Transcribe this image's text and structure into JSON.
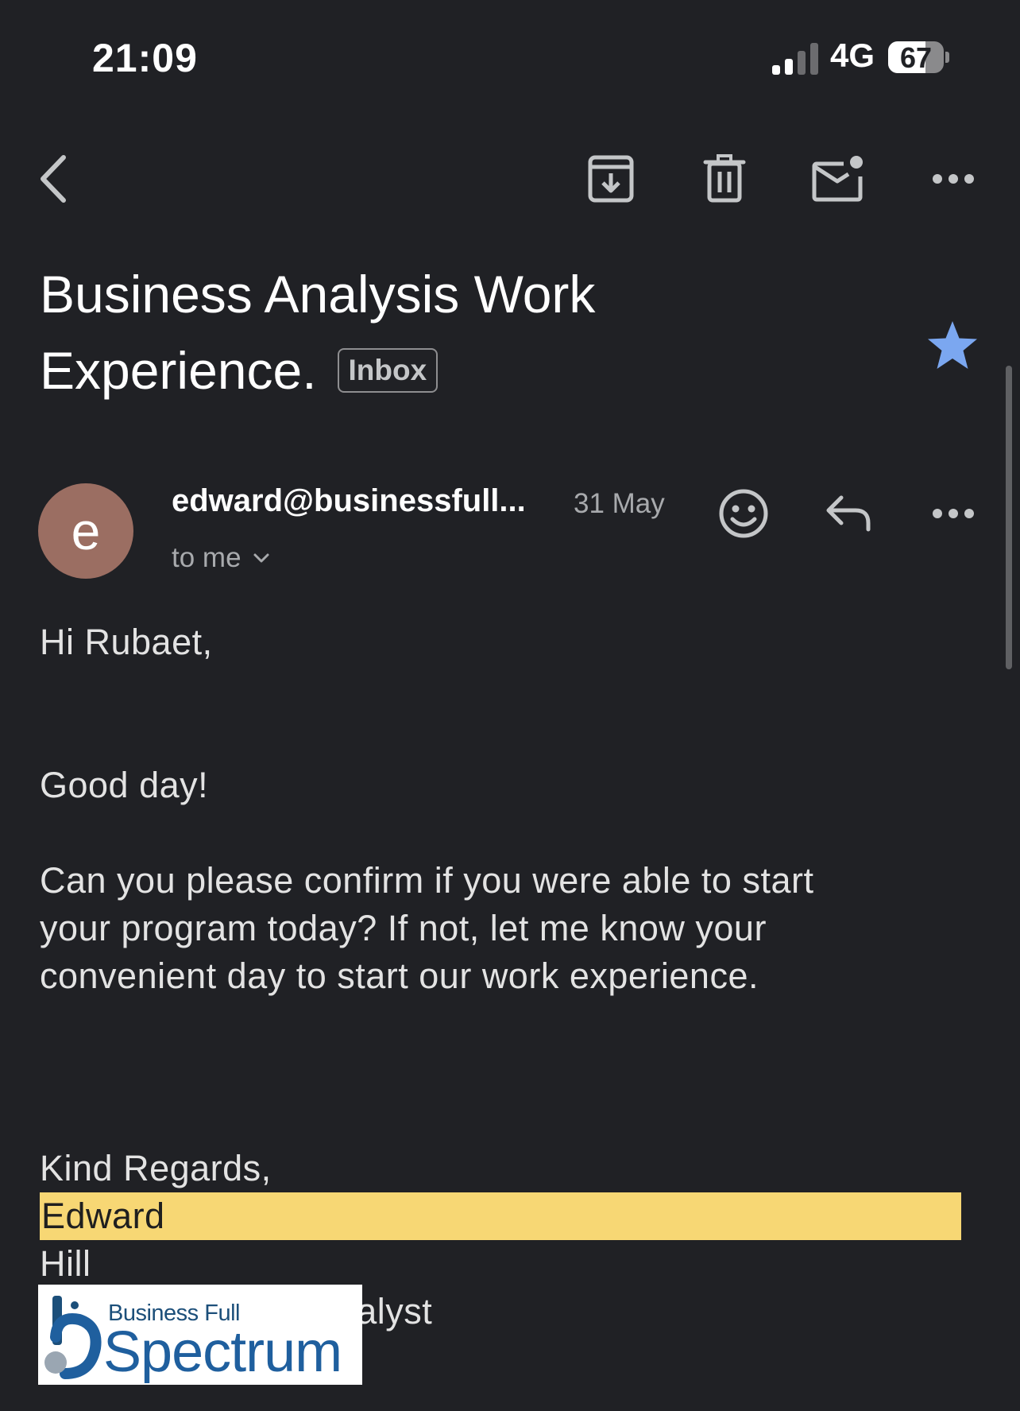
{
  "status_bar": {
    "time": "21:09",
    "network": "4G",
    "battery_percent": "67",
    "battery_level": 0.67,
    "signal_bars_active": 2,
    "signal_bars_total": 4
  },
  "toolbar": {
    "icons": [
      "back-icon",
      "archive-icon",
      "delete-icon",
      "mark-unread-icon",
      "more-icon"
    ]
  },
  "email": {
    "subject_line1": "Business Analysis Work",
    "subject_line2": "Experience.",
    "label": "Inbox",
    "starred": true,
    "star_color": "#7ba7f0",
    "sender_initial": "e",
    "avatar_color": "#9b6e62",
    "sender": "edward@businessfull...",
    "date": "31 May",
    "recipient": "to me",
    "body": {
      "greeting": "Hi Rubaet,",
      "opening": "Good day!",
      "paragraph_lines": [
        "Can you please confirm if you were able to start",
        "your program today?  If not, let me know your",
        "convenient day to start our work experience."
      ],
      "closing": "Kind Regards,",
      "signature_first_name": "Edward",
      "signature_last_name": "Hill",
      "signature_title": "Senior Business Analyst"
    },
    "logo": {
      "small_text": "Business Full",
      "big_text": "Spectrum"
    }
  }
}
